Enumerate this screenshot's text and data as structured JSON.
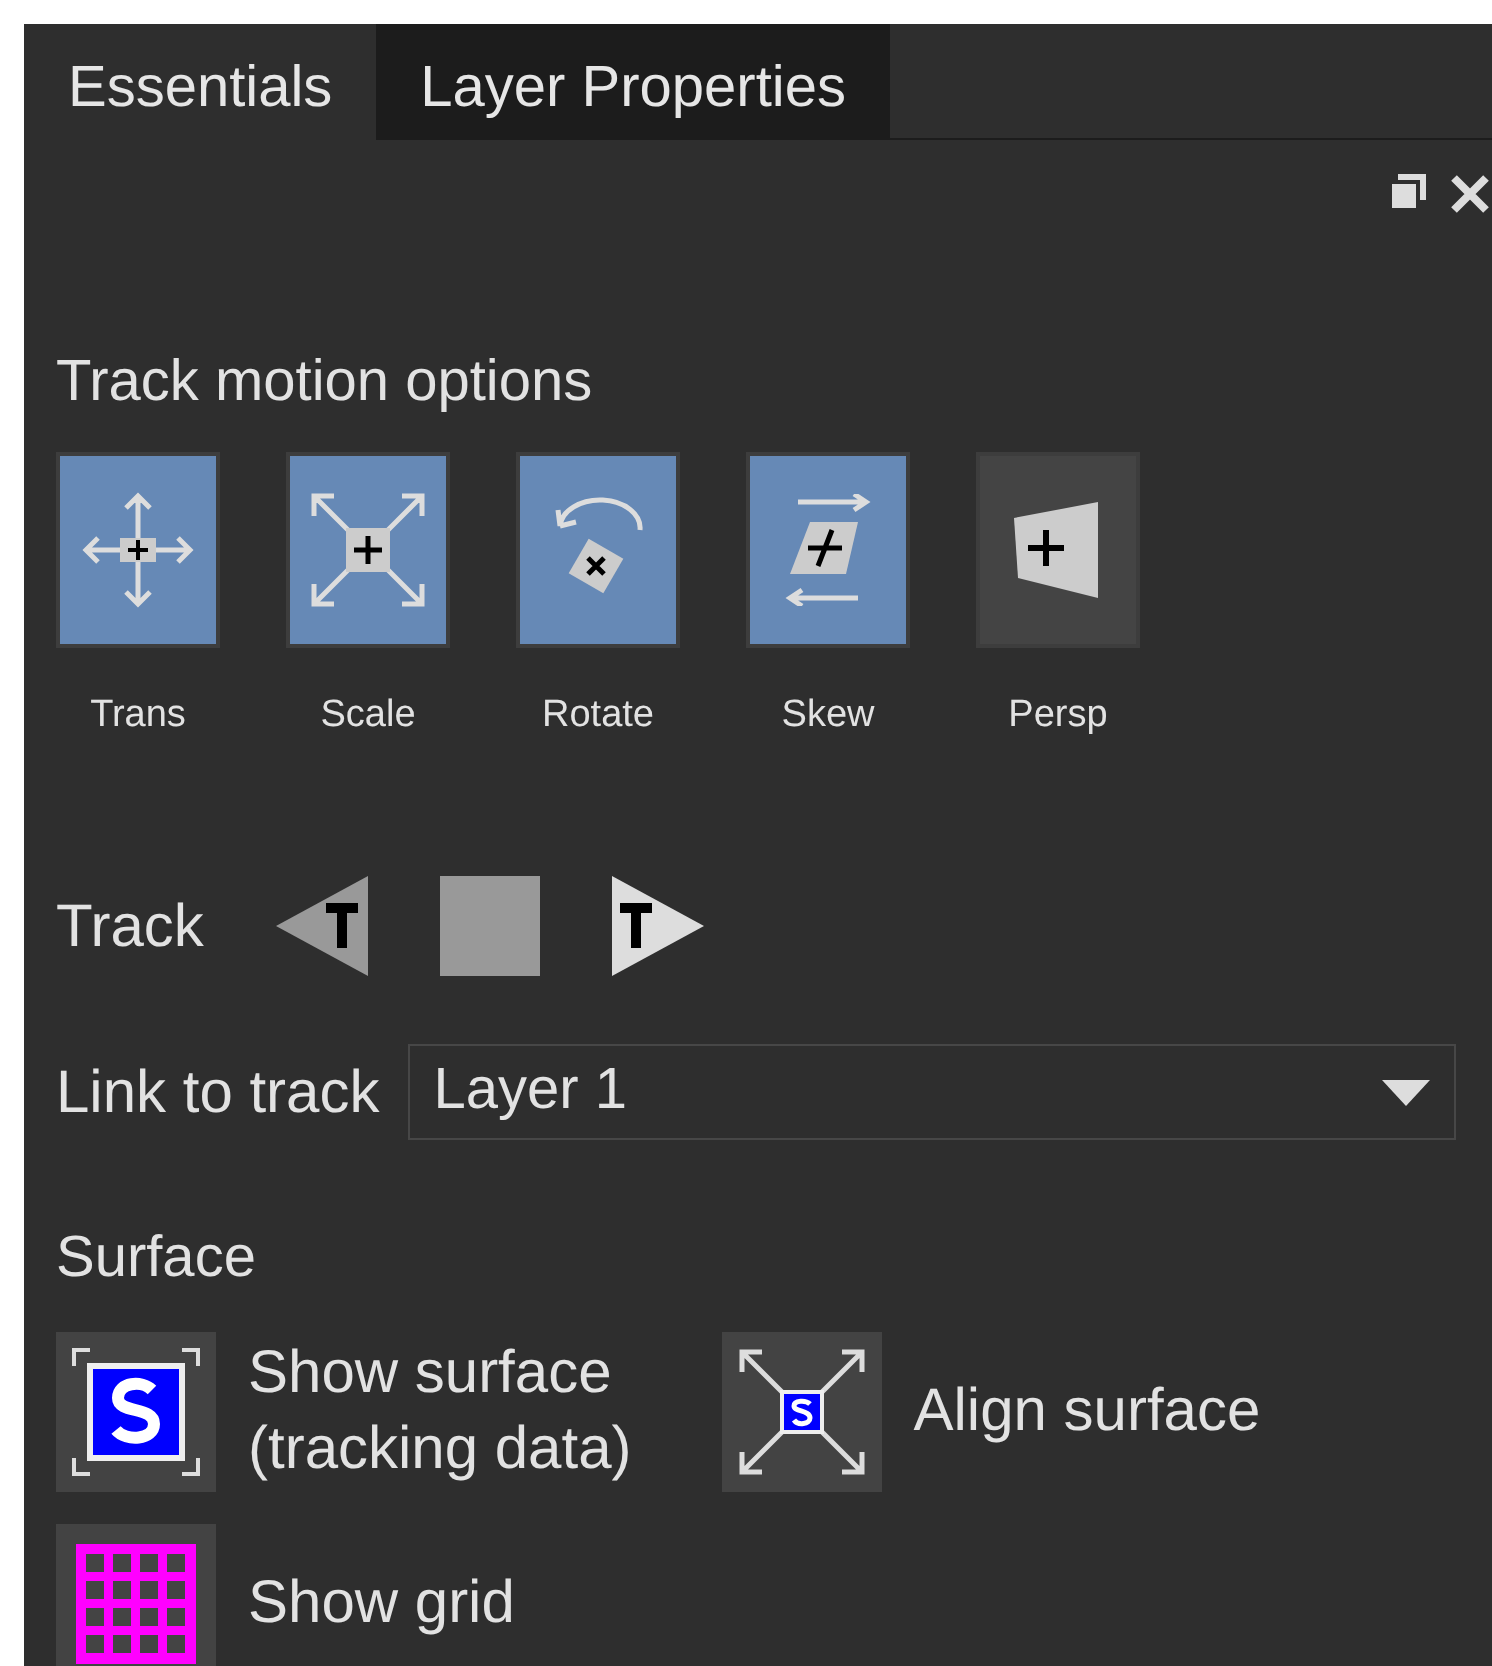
{
  "tabs": [
    {
      "label": "Essentials",
      "selected": true
    },
    {
      "label": "Layer Properties",
      "selected": false
    }
  ],
  "track_motion": {
    "title": "Track motion options",
    "options": [
      {
        "kind": "trans",
        "label": "Trans",
        "selected": true
      },
      {
        "kind": "scale",
        "label": "Scale",
        "selected": true
      },
      {
        "kind": "rotate",
        "label": "Rotate",
        "selected": true
      },
      {
        "kind": "skew",
        "label": "Skew",
        "selected": true
      },
      {
        "kind": "persp",
        "label": "Persp",
        "selected": false
      }
    ]
  },
  "track": {
    "label": "Track",
    "controls": [
      {
        "kind": "backward"
      },
      {
        "kind": "stop"
      },
      {
        "kind": "forward"
      }
    ]
  },
  "link_to_track": {
    "label": "Link to track",
    "value": "Layer 1"
  },
  "surface": {
    "title": "Surface",
    "items": [
      {
        "kind": "show-surface",
        "lines": [
          "Show surface",
          "(tracking data)"
        ]
      },
      {
        "kind": "align-surface",
        "lines": [
          "Align surface"
        ]
      },
      {
        "kind": "show-grid",
        "lines": [
          "Show grid"
        ]
      }
    ]
  }
}
